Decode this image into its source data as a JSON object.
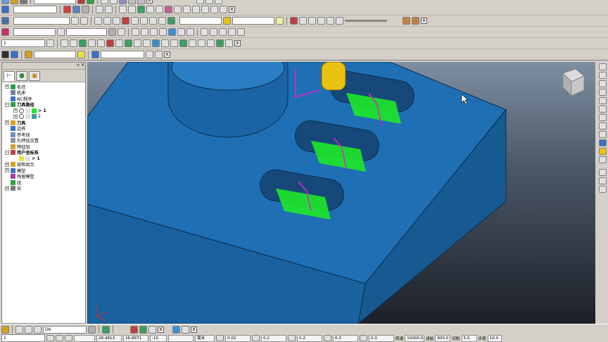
{
  "colors": {
    "accent_blue": "#1f6fb4",
    "toolpath_green": "#1ee828",
    "toolpath_magenta": "#e020d0",
    "tool_yellow": "#e8c210"
  },
  "toolbars": {
    "row1": {
      "combo1": "",
      "close": "x"
    },
    "row2": {
      "combo1": "",
      "combo2": "",
      "combo3": "",
      "close": "x"
    },
    "row3": {
      "combo1": "",
      "combo2": "",
      "combo3": ""
    },
    "row4": {
      "combo1": "1",
      "close": "x"
    },
    "row5": {
      "combo1": "",
      "combo2": "",
      "close": "x"
    }
  },
  "explorer": {
    "tab_icons": [
      "tree-icon",
      "globe-icon",
      "cup-icon"
    ],
    "items": [
      {
        "label": "刀具路径",
        "bold": true
      },
      {
        "label": "> 1",
        "bold": true
      },
      {
        "label": "2",
        "bold": false
      },
      {
        "label": "刀具",
        "bold": true
      },
      {
        "label": "边界",
        "bold": false
      },
      {
        "label": "参考线",
        "bold": false
      },
      {
        "label": "孔特征设置",
        "bold": false
      },
      {
        "label": "特征组",
        "bold": false
      },
      {
        "label": "用户坐标系",
        "bold": true
      },
      {
        "label": "> 1",
        "bold": true
      },
      {
        "label": "层和组合",
        "bold": false
      },
      {
        "label": "模型",
        "bold": false
      },
      {
        "label": "残留模型",
        "bold": false
      },
      {
        "label": "组",
        "bold": false
      },
      {
        "label": "宏",
        "bold": false
      }
    ],
    "top_items": [
      {
        "label": "毛坯",
        "bold": false
      },
      {
        "label": "机床",
        "bold": false
      },
      {
        "label": "NC程序",
        "bold": false
      }
    ]
  },
  "bottom_toolbar": {
    "combo1": "D6",
    "close": "x"
  },
  "status_bar": {
    "combo1": "1",
    "x_coord": "28.4813",
    "y_coord": "26.8671",
    "z_coord": "-15",
    "unit": "毫米",
    "tol1": "0.02",
    "tol2": "0.2",
    "tol3": "0.2",
    "dia": "6.0",
    "field_00": "0.0",
    "spindle_label": "转速",
    "spindle_value": "10000.0",
    "feed_label": "进给",
    "feed_value": "800.0",
    "cut_label": "切削",
    "cut_value": "5.0",
    "step_label": "步距",
    "step_value": "10.0"
  }
}
